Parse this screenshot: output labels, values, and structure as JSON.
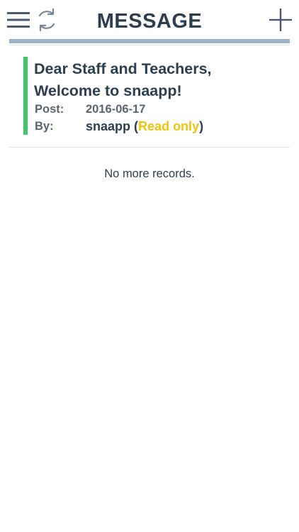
{
  "header": {
    "title": "MESSAGE",
    "menu_icon": "hamburger-menu-icon",
    "refresh_icon": "refresh-icon",
    "add_icon": "plus-icon"
  },
  "messages": [
    {
      "title": "Dear Staff and Teachers, Welcome to snaapp!",
      "post_label": "Post:",
      "post_date": "2016-06-17",
      "by_label": "By:",
      "author": "snaapp",
      "paren_open": "(",
      "access": "Read only",
      "paren_close": ")"
    }
  ],
  "footer_text": "No more records.",
  "colors": {
    "accent": "#3cc968",
    "read_only": "#f4c20d",
    "header_bar": "#9bb0c9",
    "text": "#2c3e50"
  }
}
